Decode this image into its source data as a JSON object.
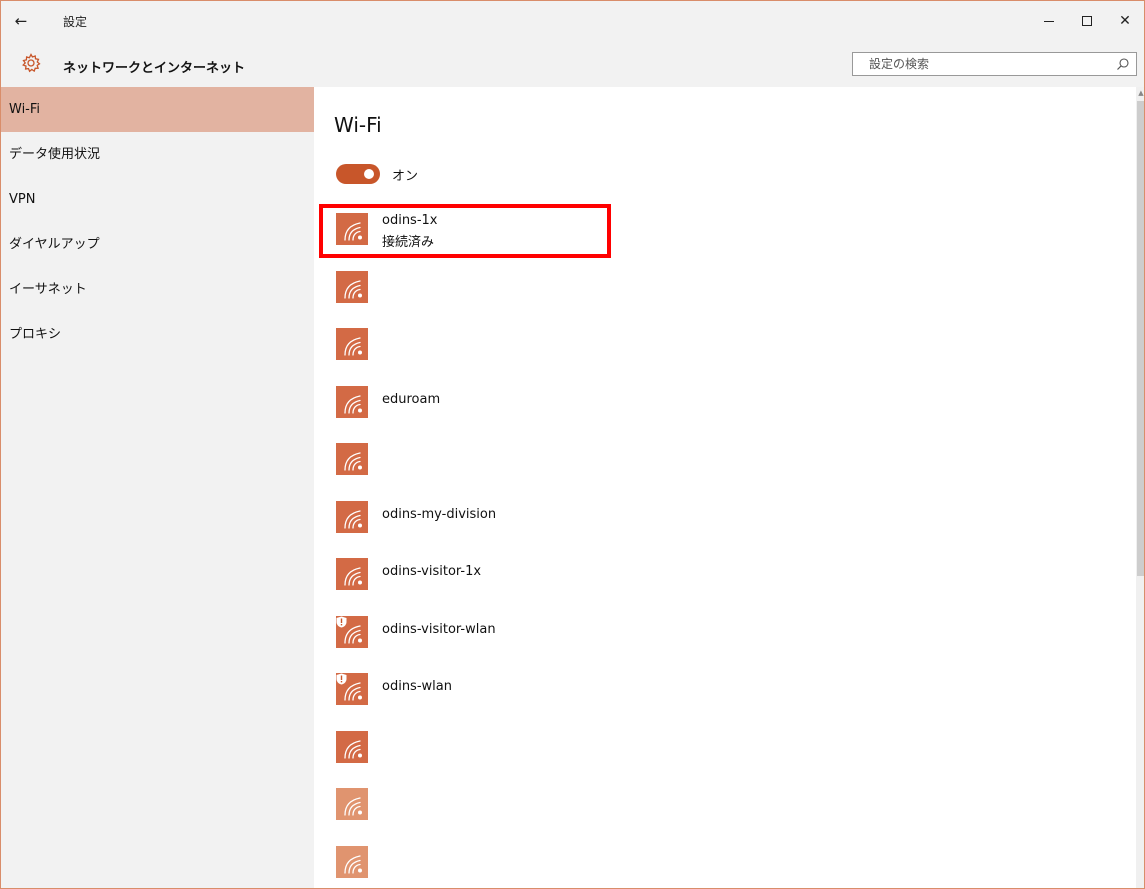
{
  "window": {
    "title": "設定",
    "back_glyph": "←",
    "close_glyph": "✕"
  },
  "header": {
    "section_title": "ネットワークとインターネット",
    "search_placeholder": "設定の検索"
  },
  "sidebar": {
    "items": [
      {
        "label": "Wi-Fi",
        "active": true
      },
      {
        "label": "データ使用状況"
      },
      {
        "label": "VPN"
      },
      {
        "label": "ダイヤルアップ"
      },
      {
        "label": "イーサネット"
      },
      {
        "label": "プロキシ"
      }
    ]
  },
  "main": {
    "title": "Wi-Fi",
    "toggle_label": "オン",
    "networks": [
      {
        "name": "odins-1x",
        "status": "接続済み"
      },
      {
        "name": ""
      },
      {
        "name": ""
      },
      {
        "name": "eduroam"
      },
      {
        "name": ""
      },
      {
        "name": "odins-my-division"
      },
      {
        "name": "odins-visitor-1x"
      },
      {
        "name": "odins-visitor-wlan",
        "shield": true
      },
      {
        "name": "odins-wlan",
        "shield": true
      },
      {
        "name": ""
      },
      {
        "name": "",
        "faded": true
      },
      {
        "name": "",
        "faded": true
      }
    ]
  },
  "colors": {
    "accent": "#c8562a",
    "sidebar_active": "#e2b3a1",
    "highlight": "#ff0000"
  }
}
